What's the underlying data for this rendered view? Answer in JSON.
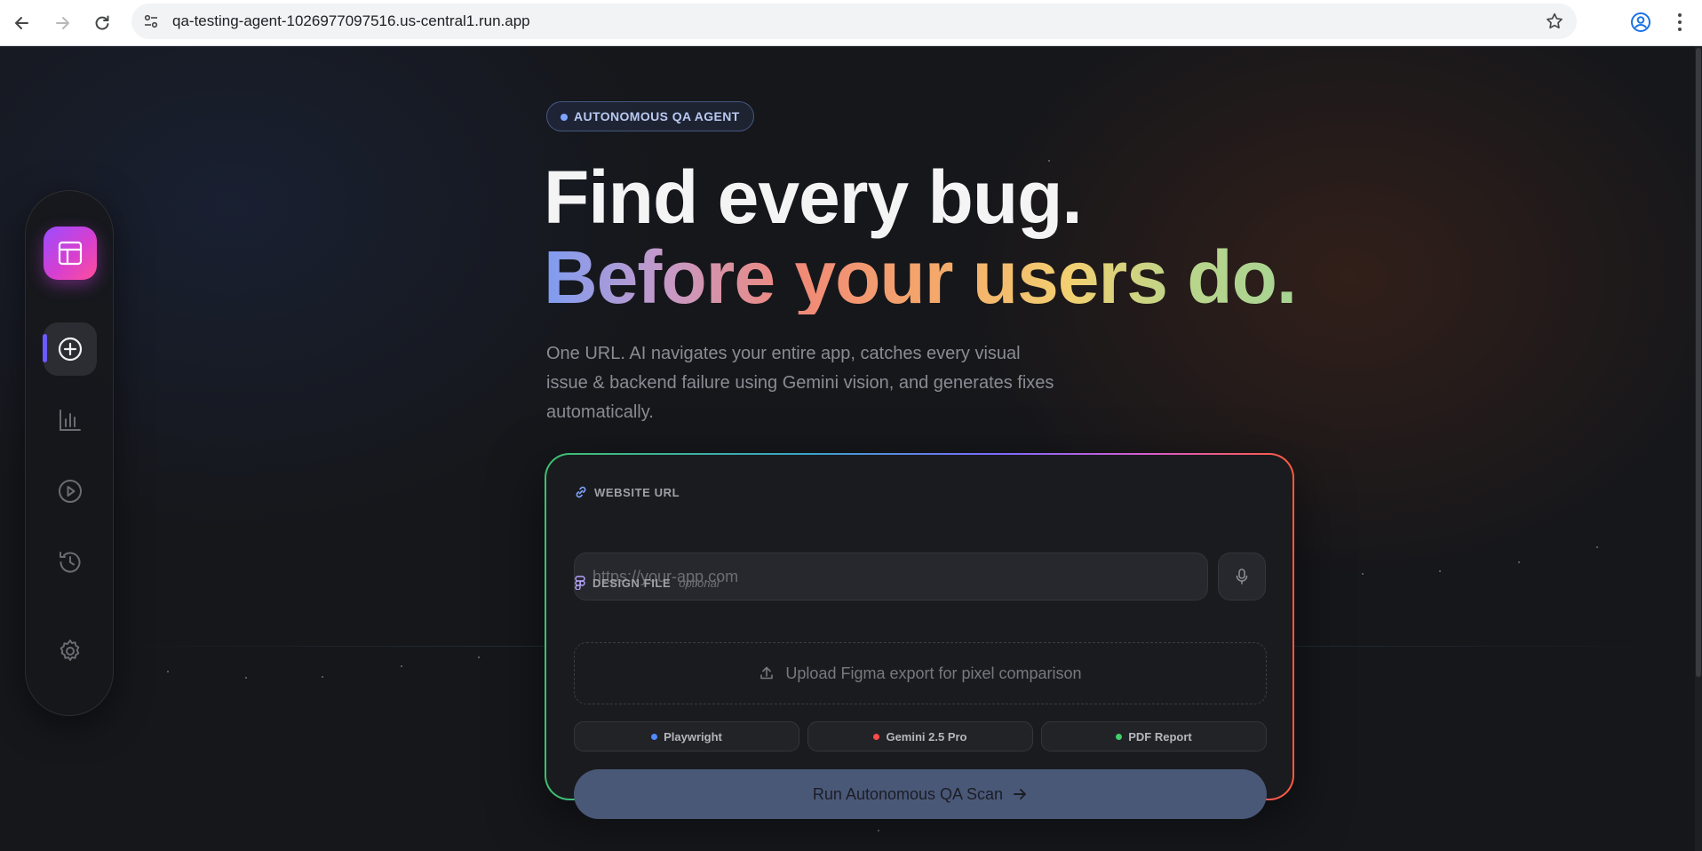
{
  "browser": {
    "url": "qa-testing-agent-1026977097516.us-central1.run.app"
  },
  "hero": {
    "badge": "AUTONOMOUS QA AGENT",
    "title_line1": "Find every bug.",
    "title_line2": "Before your users do.",
    "subtitle": "One URL. AI navigates your entire app, catches every visual issue & backend failure using Gemini vision, and generates fixes automatically."
  },
  "form": {
    "url_label": "WEBSITE URL",
    "url_value": "",
    "url_placeholder": "https://your-app.com",
    "design_label": "DESIGN FILE",
    "design_optional": "optional",
    "upload_text": "Upload Figma export for pixel comparison",
    "chips": [
      {
        "label": "Playwright",
        "color": "#4f8bff"
      },
      {
        "label": "Gemini 2.5 Pro",
        "color": "#ff4a4a"
      },
      {
        "label": "PDF Report",
        "color": "#3fcf6a"
      }
    ],
    "submit_label": "Run Autonomous QA Scan"
  },
  "colors": {
    "accent": "#6b5bff",
    "brand_gradient_start": "#9b4dff",
    "brand_gradient_end": "#ff4e9a",
    "button": "#4a5878"
  },
  "sidebar": {
    "items": [
      {
        "icon": "layout-icon"
      },
      {
        "icon": "plus-circle-icon"
      },
      {
        "icon": "bar-chart-icon"
      },
      {
        "icon": "play-circle-icon"
      },
      {
        "icon": "history-icon"
      },
      {
        "icon": "gear-icon"
      }
    ]
  }
}
